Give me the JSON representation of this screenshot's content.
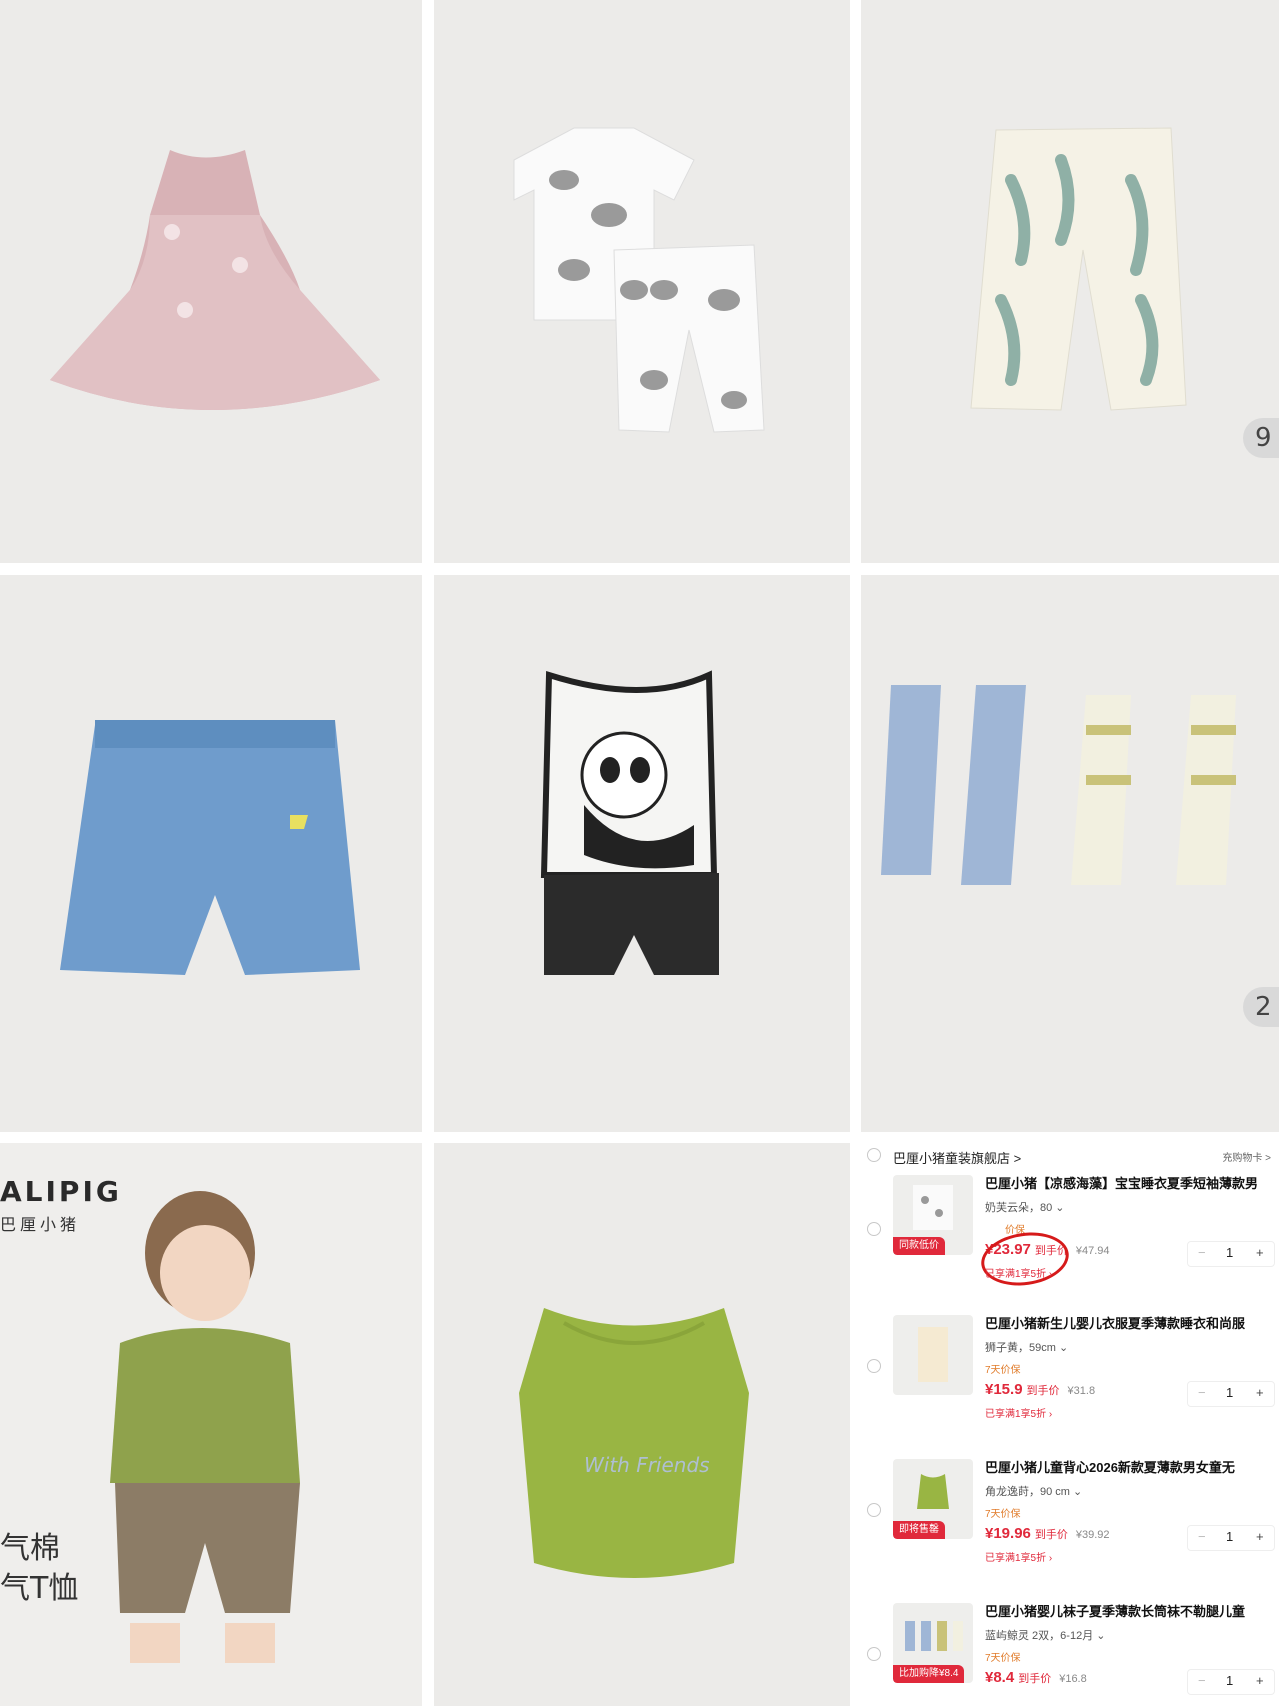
{
  "tiles": [
    {
      "name": "pink-tulle-dress"
    },
    {
      "name": "cow-print-pajama-set"
    },
    {
      "name": "banana-print-pants",
      "badge": "9"
    },
    {
      "name": "denim-shorts"
    },
    {
      "name": "panda-vest-set"
    },
    {
      "name": "fish-socks",
      "badge": "2"
    },
    {
      "name": "toddler-model-photo",
      "brand": "ALIPIG",
      "brand_cn": "巴厘小猪",
      "promo_line1": "气棉",
      "promo_line2": "气T恤"
    },
    {
      "name": "green-tank-top",
      "print_text": "With Friends"
    }
  ],
  "cart": {
    "store_name": "巴厘小猪童装旗舰店",
    "store_arrow": ">",
    "store_right": "充购物卡 >",
    "items": [
      {
        "title": "巴厘小猪【凉感海藻】宝宝睡衣夏季短袖薄款男",
        "sku": "奶芙云朵，80 ⌄",
        "guarantee": "价保",
        "price": "¥23.97",
        "price_label": "到手价",
        "original": "¥47.94",
        "discount": "已享满1享5折 ›",
        "tag": "同款低价",
        "qty": "1",
        "minus": "−",
        "plus": "+"
      },
      {
        "title": "巴厘小猪新生儿婴儿衣服夏季薄款睡衣和尚服",
        "sku": "狮子黄，59cm ⌄",
        "guarantee": "7天价保",
        "price": "¥15.9",
        "price_label": "到手价",
        "original": "¥31.8",
        "discount": "已享满1享5折 ›",
        "tag": "",
        "qty": "1",
        "minus": "−",
        "plus": "+"
      },
      {
        "title": "巴厘小猪儿童背心2026新款夏薄款男女童无",
        "sku": "角龙逸莳，90 cm ⌄",
        "guarantee": "7天价保",
        "price": "¥19.96",
        "price_label": "到手价",
        "original": "¥39.92",
        "discount": "已享满1享5折 ›",
        "tag": "即将售罄",
        "qty": "1",
        "minus": "−",
        "plus": "+"
      },
      {
        "title": "巴厘小猪婴儿袜子夏季薄款长筒袜不勒腿儿童",
        "sku": "蓝屿鲸灵 2双，6-12月 ⌄",
        "guarantee": "7天价保",
        "price": "¥8.4",
        "price_label": "到手价",
        "original": "¥16.8",
        "discount": "",
        "tag": "比加购降¥8.4",
        "qty": "1",
        "minus": "−",
        "plus": "+"
      }
    ]
  },
  "colors": {
    "accent_red": "#e0293b",
    "tile_bg": "#ecebe9",
    "guarantee_orange": "#e07b2a"
  }
}
